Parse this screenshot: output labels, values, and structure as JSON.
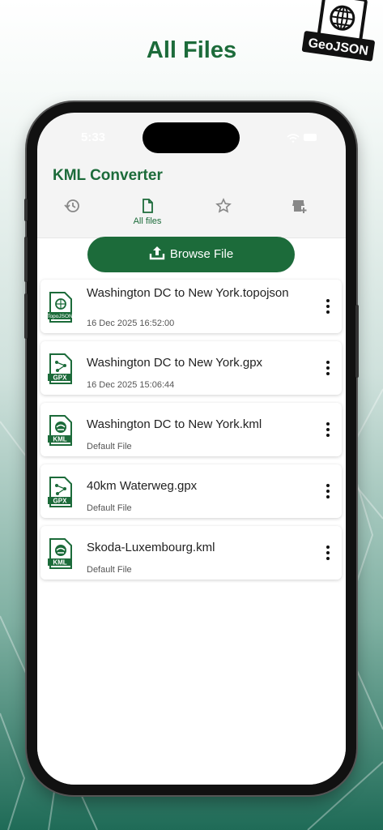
{
  "headline": "All Files",
  "badge_text": "GeoJSON",
  "status": {
    "time": "5:33"
  },
  "app_title": "KML Converter",
  "tabs": [
    {
      "name": "history",
      "icon": "history-icon",
      "label": ""
    },
    {
      "name": "all-files",
      "icon": "file-icon",
      "label": "All files"
    },
    {
      "name": "favorites",
      "icon": "star-icon",
      "label": ""
    },
    {
      "name": "store",
      "icon": "store-add-icon",
      "label": ""
    }
  ],
  "browse_label": "Browse File",
  "files": [
    {
      "name": "Washington DC to New York.topojson",
      "meta": "16 Dec 2025 16:52:00",
      "type": "TopoJSON"
    },
    {
      "name": "Washington DC to New York.gpx",
      "meta": "16 Dec 2025 15:06:44",
      "type": "GPX"
    },
    {
      "name": "Washington DC to New York.kml",
      "meta": "Default File",
      "type": "KML"
    },
    {
      "name": "40km Waterweg.gpx",
      "meta": "Default File",
      "type": "GPX"
    },
    {
      "name": "Skoda-Luxembourg.kml",
      "meta": "Default File",
      "type": "KML"
    }
  ],
  "colors": {
    "brand_green": "#1c6b3a",
    "background": "#ffffff"
  }
}
